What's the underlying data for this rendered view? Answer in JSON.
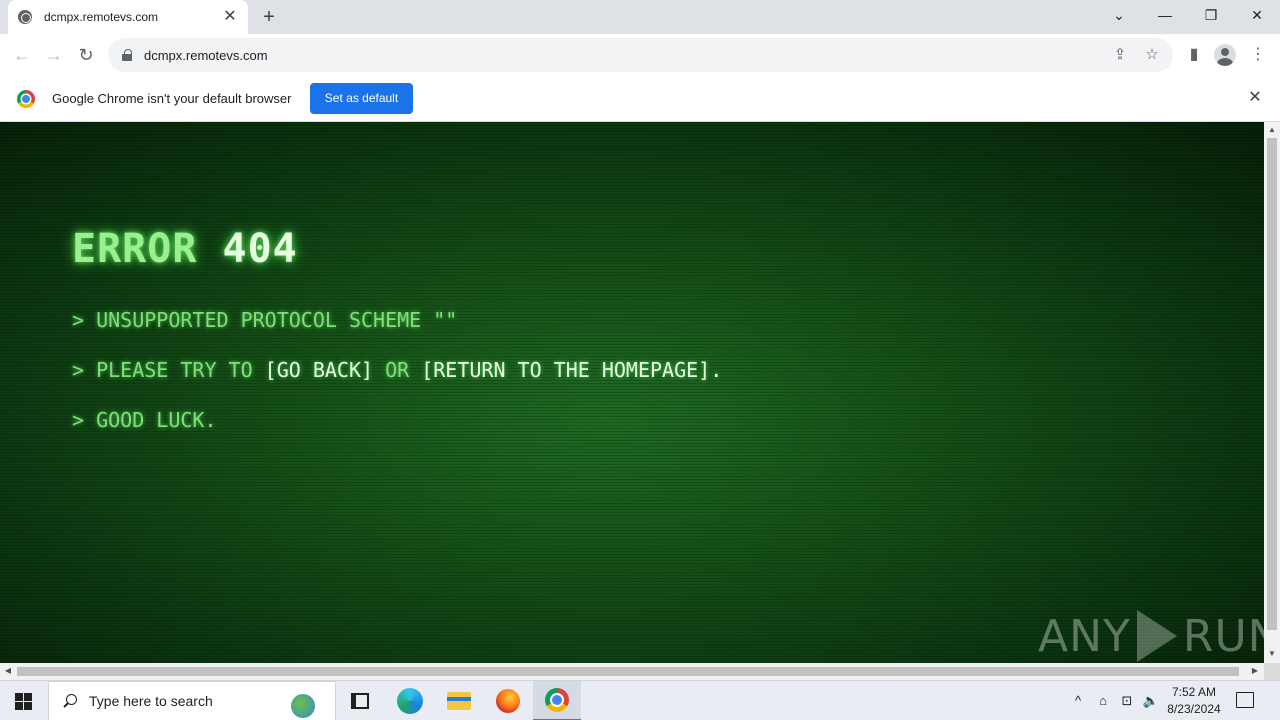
{
  "browser": {
    "tab": {
      "title": "dcmpx.remotevs.com",
      "icon": "globe-icon"
    },
    "new_tab_icon": "+",
    "window_controls": {
      "tab_search": "⌄",
      "minimize": "—",
      "restore": "❐",
      "close": "✕"
    },
    "address_bar": {
      "url": "dcmpx.remotevs.com"
    },
    "nav_icons": {
      "back": "←",
      "forward": "→",
      "reload": "↻"
    },
    "toolbar_icons": {
      "share": "⇪",
      "bookmark": "☆",
      "side_panel": "▮",
      "menu": "⋮"
    }
  },
  "infobar": {
    "message": "Google Chrome isn't your default browser",
    "button_label": "Set as default",
    "close_icon": "✕"
  },
  "page": {
    "title_word": "ERROR",
    "title_code": "404",
    "line1": "> UNSUPPORTED PROTOCOL SCHEME \"\"",
    "line2_prefix": "> PLEASE TRY TO ",
    "go_back_link": "[GO BACK]",
    "line2_middle": " OR ",
    "homepage_link": "[RETURN TO THE HOMEPAGE].",
    "line3": "> GOOD LUCK.",
    "watermark_left": "ANY",
    "watermark_right": "RUN"
  },
  "taskbar": {
    "search_placeholder": "Type here to search",
    "tray_icons": {
      "chevron": "^",
      "meet": "⌂",
      "network": "⊡",
      "volume": "🔈"
    },
    "time": "7:52 AM",
    "date": "8/23/2024"
  },
  "colors": {
    "accent": "#1a73e8",
    "terminal_green": "#7fe07a",
    "terminal_bright": "#e8ffe4"
  }
}
